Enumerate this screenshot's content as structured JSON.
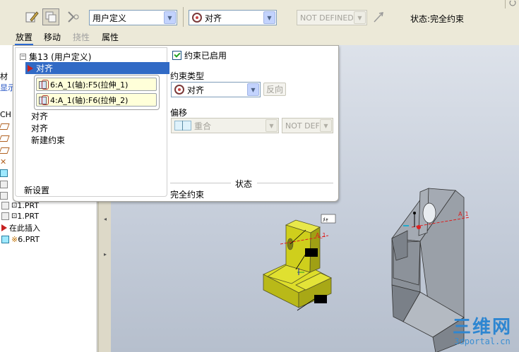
{
  "toolbar": {
    "constraint_set_value": "用户定义",
    "constraint_type_value": "对齐",
    "offset_value": "NOT DEFINED",
    "status_text": "状态:完全约束"
  },
  "tabs": [
    {
      "label": "放置",
      "state": "active"
    },
    {
      "label": "移动",
      "state": "normal"
    },
    {
      "label": "挠性",
      "state": "disabled"
    },
    {
      "label": "属性",
      "state": "normal"
    }
  ],
  "tree": {
    "partial_labels": [
      "材",
      "显示",
      "CH"
    ],
    "items": [
      {
        "label": "1.PRT",
        "prefix": "⊡"
      },
      {
        "label": "1.PRT",
        "prefix": "⊡"
      },
      {
        "label": "在此插入",
        "prefix": ""
      },
      {
        "label": "6.PRT",
        "prefix": "※"
      }
    ]
  },
  "panel": {
    "set_label": "集13 (用户定义)",
    "selected_constraint": "对齐",
    "references": [
      "6:A_1(轴):F5(拉伸_1)",
      "4:A_1(轴):F6(拉伸_2)"
    ],
    "other_constraints": [
      "对齐",
      "对齐",
      "新建约束"
    ],
    "new_set_label": "新设置",
    "enabled_label": "约束已启用",
    "type_label": "约束类型",
    "type_value": "对齐",
    "reverse_label": "反向",
    "offset_label": "偏移",
    "offset_value": "重合",
    "offset_dim_value": "NOT DEFI",
    "status_label": "状态",
    "status_value": "完全约束"
  },
  "viewport": {
    "axis_label_1": "A_1",
    "axis_label_2": "A_1"
  },
  "watermark": {
    "logo": "三维网",
    "url": "3dportal.cn"
  },
  "colors": {
    "part_yellow": "#cfcf1c",
    "part_gray": "#8e949c",
    "selection_blue": "#316ac5"
  }
}
